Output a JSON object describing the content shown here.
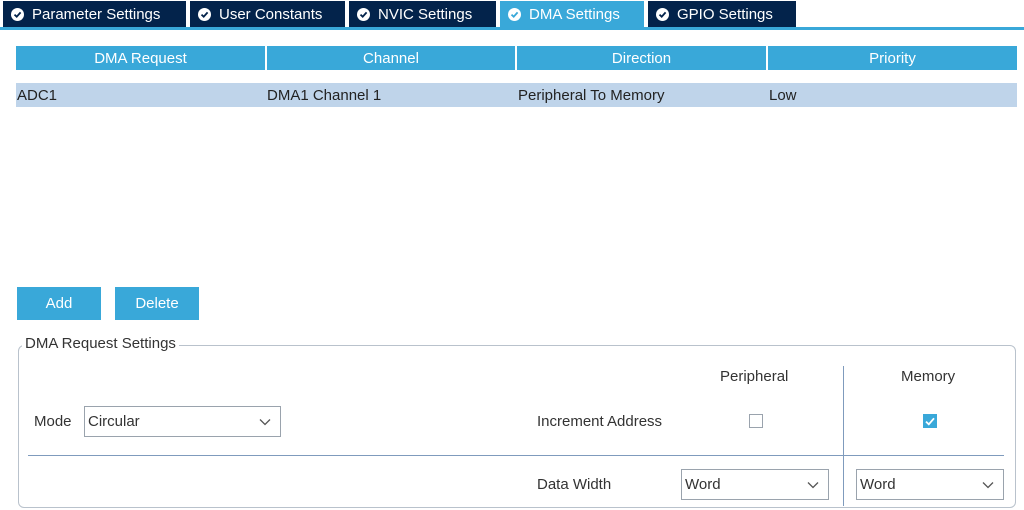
{
  "tabs": [
    {
      "label": "Parameter Settings",
      "active": false
    },
    {
      "label": "User Constants",
      "active": false
    },
    {
      "label": "NVIC Settings",
      "active": false
    },
    {
      "label": "DMA Settings",
      "active": true
    },
    {
      "label": "GPIO Settings",
      "active": false
    }
  ],
  "table": {
    "headers": [
      "DMA Request",
      "Channel",
      "Direction",
      "Priority"
    ],
    "rows": [
      [
        "ADC1",
        "DMA1 Channel 1",
        "Peripheral To Memory",
        "Low"
      ]
    ]
  },
  "buttons": {
    "add": "Add",
    "delete": "Delete"
  },
  "settings": {
    "legend": "DMA Request Settings",
    "mode_label": "Mode",
    "mode_value": "Circular",
    "peripheral_header": "Peripheral",
    "memory_header": "Memory",
    "increment_label": "Increment Address",
    "peripheral_increment": false,
    "memory_increment": true,
    "data_width_label": "Data Width",
    "peripheral_width": "Word",
    "memory_width": "Word"
  },
  "colors": {
    "accent": "#39a8d9",
    "tab_dark": "#03234b",
    "row_selected": "#bfd4ea"
  }
}
